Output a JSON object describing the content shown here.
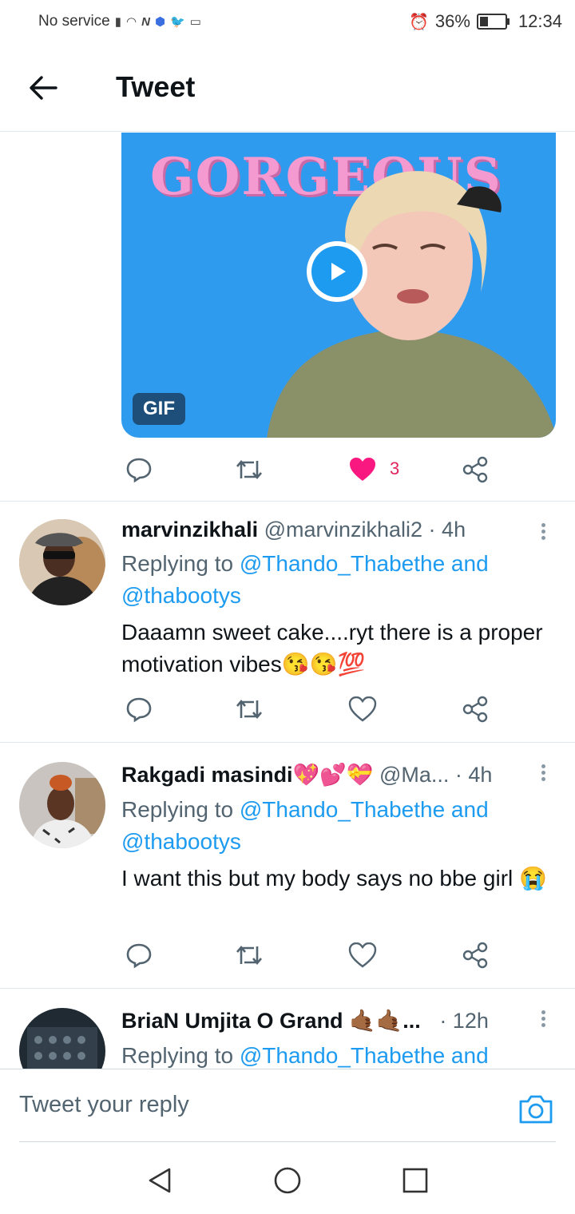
{
  "status_bar": {
    "carrier": "No service",
    "battery": "36%",
    "time": "12:34"
  },
  "header": {
    "title": "Tweet",
    "back_icon": "arrow-left-icon"
  },
  "media": {
    "overlay_text": "GORGEOUS",
    "badge": "GIF",
    "play_icon": "play-icon"
  },
  "main_actions": {
    "like_count": "3",
    "liked": true
  },
  "replies": [
    {
      "name": "marvinzikhali",
      "handle": "@marvinzikhali2 · 4h",
      "replying_prefix": "Replying to ",
      "replying_to_1": "@Thando_Thabethe and",
      "replying_to_2": "@thabootys",
      "text": "Daaamn sweet cake....ryt there is a proper motivation vibes😘😘💯"
    },
    {
      "name": "Rakgadi masindi💖💕💝",
      "handle": "@Ma... · 4h",
      "replying_prefix": "Replying to ",
      "replying_to_1": "@Thando_Thabethe and",
      "replying_to_2": "@thabootys",
      "text": "I want this but my body says no bbe girl 😭"
    },
    {
      "name": "BriaN Umjita O Grand 🤙🏾🤙🏾...",
      "handle": "· 12h",
      "replying_prefix": "Replying to ",
      "replying_to_1": "@Thando_Thabethe and"
    }
  ],
  "composer": {
    "placeholder": "Tweet your reply",
    "camera_icon": "camera-icon"
  },
  "colors": {
    "accent": "#1d9bf0",
    "like": "#e0245e",
    "secondary_text": "#536471"
  }
}
